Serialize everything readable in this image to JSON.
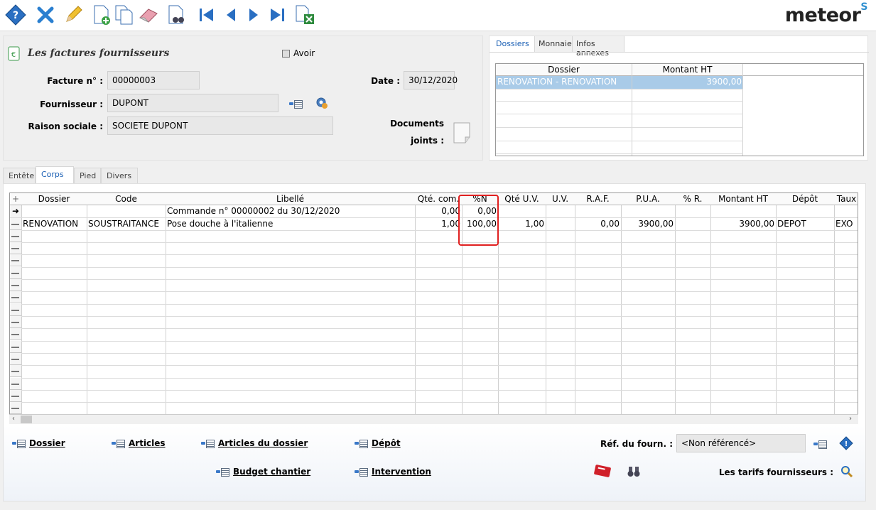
{
  "app": {
    "logo_text": "meteor",
    "logo_mark": "S"
  },
  "toolbar": {
    "icons": [
      "help-diamond-icon",
      "delete-x-icon",
      "edit-pencil-icon",
      "new-document-icon",
      "copy-documents-icon",
      "eraser-icon",
      "search-binoculars-doc-icon",
      "first-record-icon",
      "previous-record-icon",
      "next-record-icon",
      "last-record-icon",
      "export-excel-icon"
    ]
  },
  "header": {
    "title": "Les factures fournisseurs",
    "avoir_label": "Avoir",
    "facture_label": "Facture n° :",
    "facture_value": "00000003",
    "date_label": "Date :",
    "date_value": "30/12/2020",
    "fournisseur_label": "Fournisseur :",
    "fournisseur_value": "DUPONT",
    "raison_label": "Raison sociale :",
    "raison_value": "SOCIETE DUPONT",
    "documents_label_1": "Documents",
    "documents_label_2": "joints :"
  },
  "right_panel": {
    "tabs": [
      "Dossiers",
      "Monnaie",
      "Infos annexes"
    ],
    "columns": [
      "Dossier",
      "Montant HT"
    ],
    "rows": [
      [
        "RENOVATION - RENOVATION",
        "3900,00"
      ]
    ]
  },
  "bottom_tabs": [
    {
      "label": "Entête"
    },
    {
      "label": "Corps"
    },
    {
      "label": "Pied"
    },
    {
      "label": "Divers"
    }
  ],
  "grid": {
    "add_symbol": "+",
    "columns": [
      "Dossier",
      "Code",
      "Libellé",
      "Qté. com.",
      "%N",
      "Qté U.V.",
      "U.V.",
      "R.A.F.",
      "P.U.A.",
      "% R.",
      "Montant HT",
      "Dépôt",
      "Taux"
    ],
    "rows": [
      {
        "marker": "➜",
        "dossier": "",
        "code": "",
        "libelle": "Commande n° 00000002 du 30/12/2020",
        "qte_com": "0,00",
        "pct_n": "0,00",
        "qte_uv": "",
        "uv": "",
        "raf": "",
        "pua": "",
        "pct_r": "",
        "montant_ht": "",
        "depot": "",
        "taux": ""
      },
      {
        "marker": "",
        "dossier": "RENOVATION",
        "code": "SOUSTRAITANCE",
        "libelle": "Pose douche à l'italienne",
        "qte_com": "1,00",
        "pct_n": "100,00",
        "qte_uv": "1,00",
        "uv": "",
        "raf": "0,00",
        "pua": "3900,00",
        "pct_r": "",
        "montant_ht": "3900,00",
        "depot": "DEPOT",
        "taux": "EXO"
      }
    ]
  },
  "actions": {
    "dossier": "Dossier",
    "articles": "Articles",
    "articles_dossier": "Articles du dossier",
    "depot": "Dépôt",
    "budget": "Budget chantier",
    "intervention": "Intervention",
    "ref_fourn_label": "Réf. du fourn. :",
    "ref_fourn_value": "<Non référencé>",
    "tarifs_label": "Les tarifs fournisseurs :"
  }
}
